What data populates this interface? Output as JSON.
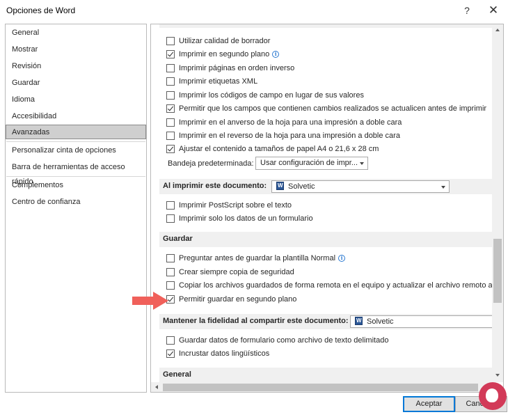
{
  "window": {
    "title": "Opciones de Word",
    "help_label": "?",
    "close_label": "✕"
  },
  "sidebar": {
    "items": [
      {
        "label": "General"
      },
      {
        "label": "Mostrar"
      },
      {
        "label": "Revisión"
      },
      {
        "label": "Guardar"
      },
      {
        "label": "Idioma"
      },
      {
        "label": "Accesibilidad"
      },
      {
        "label": "Avanzadas",
        "selected": true
      },
      {
        "label": "Personalizar cinta de opciones"
      },
      {
        "label": "Barra de herramientas de acceso rápido"
      },
      {
        "label": "Complementos"
      },
      {
        "label": "Centro de confianza"
      }
    ]
  },
  "print": {
    "options": [
      {
        "label": "Utilizar calidad de borrador",
        "checked": false
      },
      {
        "label": "Imprimir en segundo plano",
        "checked": true,
        "info": true
      },
      {
        "label": "Imprimir páginas en orden inverso",
        "checked": false
      },
      {
        "label": "Imprimir etiquetas XML",
        "checked": false
      },
      {
        "label": "Imprimir los códigos de campo en lugar de sus valores",
        "checked": false
      },
      {
        "label": "Permitir que los campos que contienen cambios realizados se actualicen antes de imprimir",
        "checked": true
      },
      {
        "label": "Imprimir en el anverso de la hoja para una impresión a doble cara",
        "checked": false
      },
      {
        "label": "Imprimir en el reverso de la hoja para una impresión a doble cara",
        "checked": false
      },
      {
        "label": "Ajustar el contenido a tamaños de papel A4 o 21,6 x 28 cm",
        "checked": true
      }
    ],
    "tray_label": "Bandeja predeterminada:",
    "tray_value": "Usar configuración de impr..."
  },
  "print_document": {
    "title": "Al imprimir este documento:",
    "document_value": "Solvetic",
    "options": [
      {
        "label": "Imprimir PostScript sobre el texto",
        "checked": false
      },
      {
        "label": "Imprimir solo los datos de un formulario",
        "checked": false
      }
    ]
  },
  "save": {
    "title": "Guardar",
    "options": [
      {
        "label": "Preguntar antes de guardar la plantilla Normal",
        "checked": false,
        "info": true
      },
      {
        "label": "Crear siempre copia de seguridad",
        "checked": false
      },
      {
        "label": "Copiar los archivos guardados de forma remota en el equipo y actualizar el archivo remoto al gua",
        "checked": false
      },
      {
        "label": "Permitir guardar en segundo plano",
        "checked": true
      }
    ]
  },
  "fidelity": {
    "title": "Mantener la fidelidad al compartir este documento:",
    "document_value": "Solvetic",
    "options": [
      {
        "label": "Guardar datos de formulario como archivo de texto delimitado",
        "checked": false
      },
      {
        "label": "Incrustar datos lingüísticos",
        "checked": true
      }
    ]
  },
  "general": {
    "title": "General"
  },
  "footer": {
    "accept_label": "Aceptar",
    "cancel_label": "Cancelar"
  },
  "colors": {
    "annotation_arrow": "#f0605a",
    "selected_nav": "#cfcfcf",
    "primary_border": "#0078d7"
  }
}
